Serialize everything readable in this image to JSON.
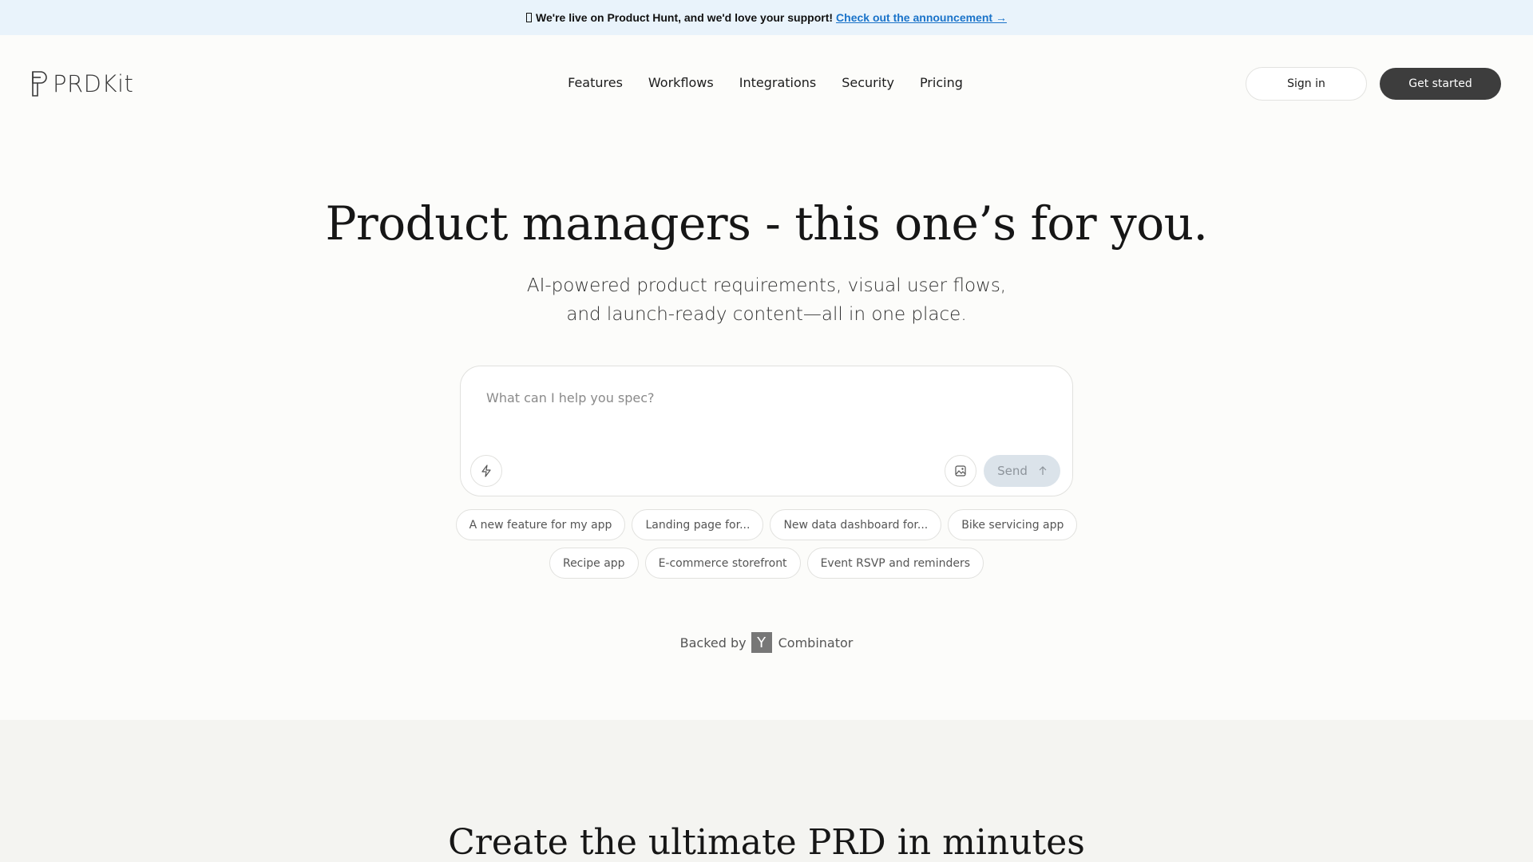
{
  "banner": {
    "text": "We're live on Product Hunt, and we'd love your support!",
    "link": "Check out the announcement →"
  },
  "logo": {
    "name": "PRDKit"
  },
  "nav": {
    "links": [
      "Features",
      "Workflows",
      "Integrations",
      "Security",
      "Pricing"
    ],
    "signin": "Sign in",
    "get_started": "Get started"
  },
  "hero": {
    "title": "Product managers - this one’s for you.",
    "subtitle_line1": "AI-powered product requirements, visual user flows,",
    "subtitle_line2": "and launch-ready content—all in one place."
  },
  "prompt": {
    "placeholder": "What can I help you spec?",
    "send_label": "Send",
    "icons": {
      "left": "lightning-icon",
      "image": "image-icon",
      "send": "arrow-up-icon"
    }
  },
  "suggestions": {
    "row1": [
      "A new feature for my app",
      "Landing page for...",
      "New data dashboard for...",
      "Bike servicing app"
    ],
    "row2": [
      "Recipe app",
      "E-commerce storefront",
      "Event RSVP and reminders"
    ]
  },
  "backed": {
    "prefix": "Backed by",
    "logo": "Y",
    "suffix": "Combinator"
  },
  "section2": {
    "title": "Create the ultimate PRD in minutes"
  },
  "colors": {
    "banner_bg": "#e9f3fb",
    "link": "#1a73c9",
    "primary_button": "#3d3d3d",
    "send_button": "#dbe3ea",
    "page_bg": "#fcfcfa"
  }
}
